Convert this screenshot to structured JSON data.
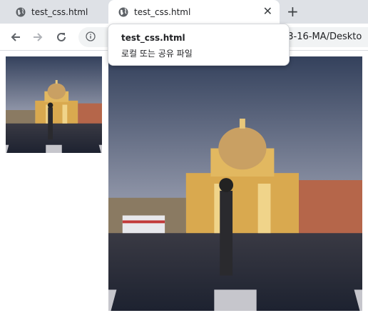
{
  "tabs": [
    {
      "title": "test_css.html",
      "active": false
    },
    {
      "title": "test_css.html",
      "active": true
    }
  ],
  "new_tab_icon": "plus-icon",
  "close_icon": "close-icon",
  "toolbar": {
    "url_visible": "73-16-MA/Deskto"
  },
  "tooltip": {
    "title": "test_css.html",
    "subtitle": "로컬 또는 공유 파일"
  },
  "images": [
    {
      "name": "photo-small",
      "description_icon": "photo"
    },
    {
      "name": "photo-large",
      "description_icon": "photo"
    }
  ],
  "colors": {
    "tabstrip": "#dee1e6",
    "sky_top": "#3b4a66",
    "sky_bottom": "#a8aab5",
    "building": "#e0b45c",
    "ground": "#232a38"
  }
}
